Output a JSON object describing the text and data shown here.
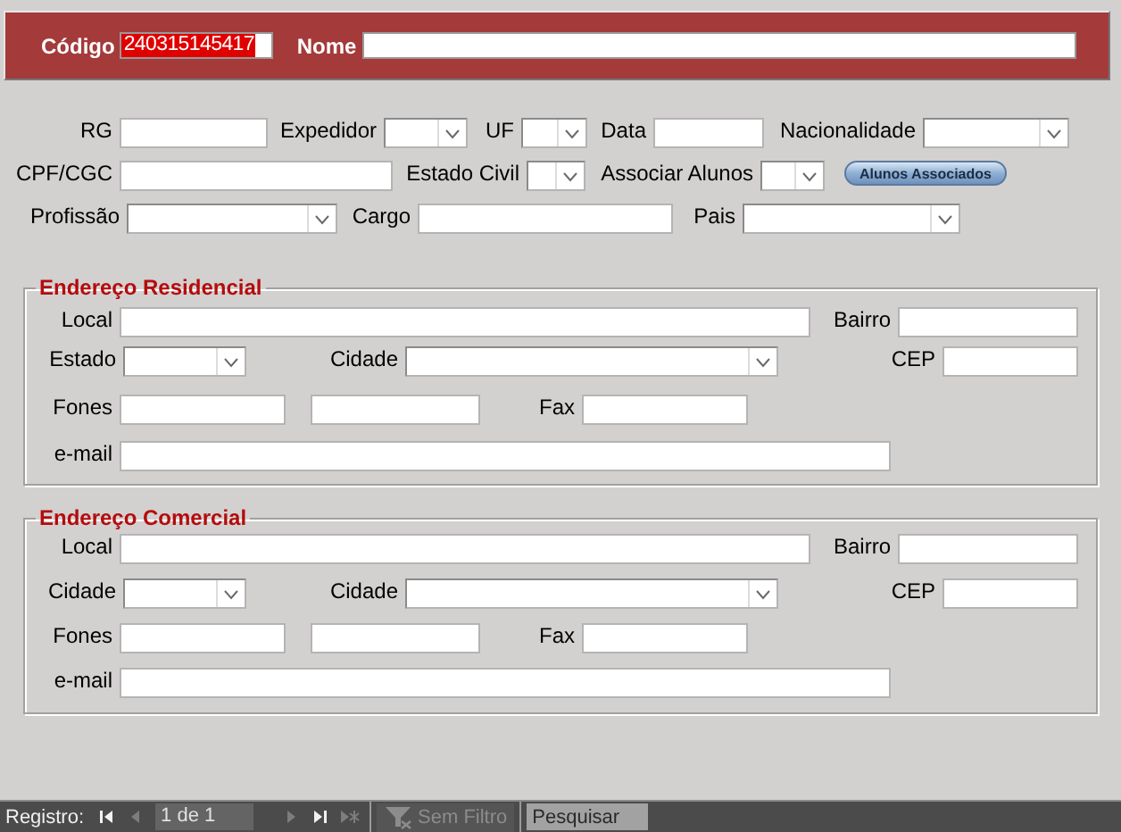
{
  "header": [
    {
      "label": "Código",
      "value": "240315145417",
      "highlighted": true
    },
    {
      "label": "Nome"
    }
  ],
  "rows": [
    [
      {
        "label": "RG",
        "kind": "text"
      },
      {
        "label": "Expedidor",
        "kind": "combo"
      },
      {
        "label": "UF",
        "kind": "combo"
      },
      {
        "label": "Data",
        "kind": "text"
      },
      {
        "label": "Nacionalidade",
        "kind": "combo"
      }
    ],
    [
      {
        "label": "CPF/CGC",
        "kind": "text"
      },
      {
        "label": "Estado Civil",
        "kind": "combo"
      },
      {
        "label": "Associar Alunos",
        "kind": "combo"
      },
      {
        "kind": "button",
        "text": "Alunos Associados"
      }
    ],
    [
      {
        "label": "Profissão",
        "kind": "combo"
      },
      {
        "label": "Cargo",
        "kind": "text"
      },
      {
        "label": "Pais",
        "kind": "combo"
      }
    ]
  ],
  "sections": [
    {
      "title": "Endereço Residencial",
      "rows": [
        [
          {
            "label": "Local",
            "kind": "text"
          },
          {
            "label": "Bairro",
            "kind": "text"
          }
        ],
        [
          {
            "label": "Estado",
            "kind": "combo"
          },
          {
            "label": "Cidade",
            "kind": "combo"
          },
          {
            "label": "CEP",
            "kind": "text"
          }
        ],
        [
          {
            "label": "Fones",
            "kind": "text"
          },
          {
            "kind": "text"
          },
          {
            "label": "Fax",
            "kind": "text"
          }
        ],
        [
          {
            "label": "e-mail",
            "kind": "text"
          }
        ]
      ]
    },
    {
      "title": "Endereço Comercial",
      "rows": [
        [
          {
            "label": "Local",
            "kind": "text"
          },
          {
            "label": "Bairro",
            "kind": "text"
          }
        ],
        [
          {
            "label": "Cidade",
            "kind": "combo"
          },
          {
            "label": "Cidade",
            "kind": "combo"
          },
          {
            "label": "CEP",
            "kind": "text"
          }
        ],
        [
          {
            "label": "Fones",
            "kind": "text"
          },
          {
            "kind": "text"
          },
          {
            "label": "Fax",
            "kind": "text"
          }
        ],
        [
          {
            "label": "e-mail",
            "kind": "text"
          }
        ]
      ]
    }
  ],
  "status_bar": {
    "label": "Registro:",
    "position": "1 de 1",
    "nav": [
      {
        "kind": "first",
        "disabled": false
      },
      {
        "kind": "previous",
        "disabled": true
      },
      {
        "kind": "next",
        "disabled": true
      },
      {
        "kind": "last",
        "disabled": false
      },
      {
        "kind": "new",
        "disabled": true
      }
    ],
    "filter": {
      "text": "Sem Filtro",
      "disabled": true
    },
    "search": {
      "placeholder": "Pesquisar"
    }
  }
}
